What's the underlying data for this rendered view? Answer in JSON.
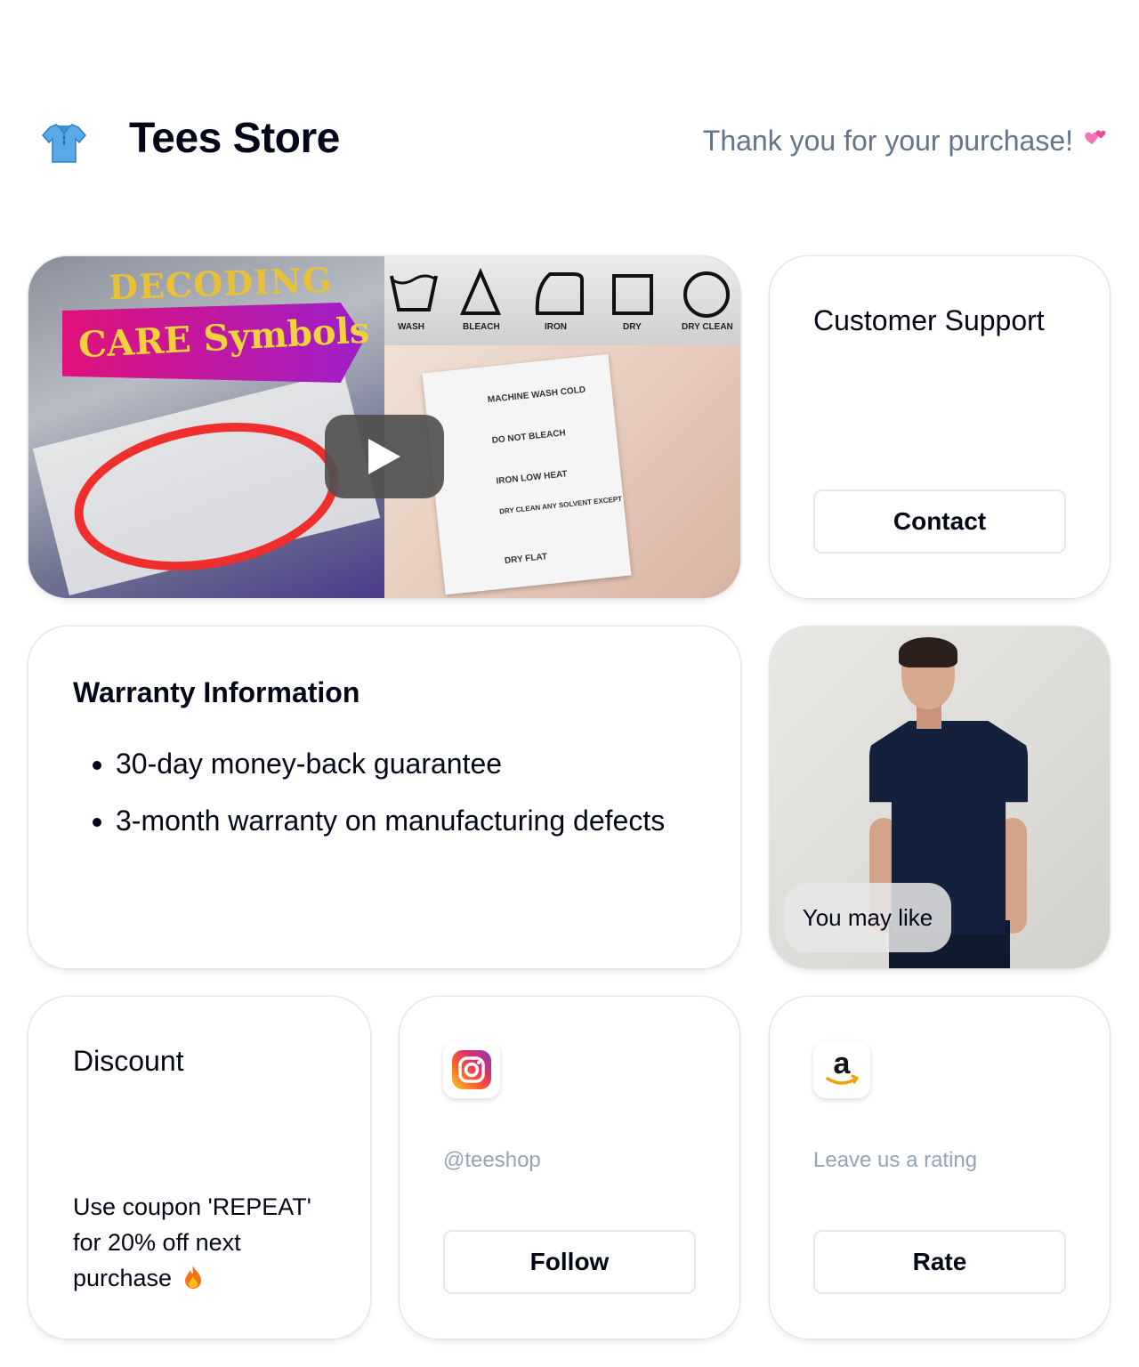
{
  "header": {
    "store_name": "Tees Store",
    "thanks_message": "Thank you for your purchase!",
    "logo_icon": "tshirt-icon",
    "heart_icon": "two-hearts-icon"
  },
  "video": {
    "title_line1": "DECODING",
    "title_line2": "CARE Symbols",
    "symbol_labels": [
      "WASH",
      "BLEACH",
      "IRON",
      "DRY",
      "DRY CLEAN"
    ],
    "label_lines": [
      "MACHINE WASH COLD",
      "DO NOT BLEACH",
      "IRON LOW HEAT",
      "DRY CLEAN ANY SOLVENT EXCEPT TRICHLOROETHYLENE",
      "DRY FLAT"
    ],
    "play_icon": "play-icon"
  },
  "support": {
    "title": "Customer Support",
    "button_label": "Contact"
  },
  "warranty": {
    "title": "Warranty Information",
    "items": [
      "30-day money-back guarantee",
      "3-month warranty on manufacturing defects"
    ]
  },
  "product": {
    "chip_label": "You may like"
  },
  "discount": {
    "title": "Discount",
    "text": "Use coupon 'REPEAT' for 20% off next purchase",
    "emoji_icon": "fire-icon"
  },
  "instagram": {
    "handle": "@teeshop",
    "button_label": "Follow",
    "icon": "instagram-icon"
  },
  "amazon": {
    "text": "Leave us a rating",
    "button_label": "Rate",
    "icon": "amazon-icon"
  },
  "colors": {
    "muted_text": "#64748b",
    "placeholder_text": "#94a3b8",
    "border": "#e2e8f0"
  }
}
